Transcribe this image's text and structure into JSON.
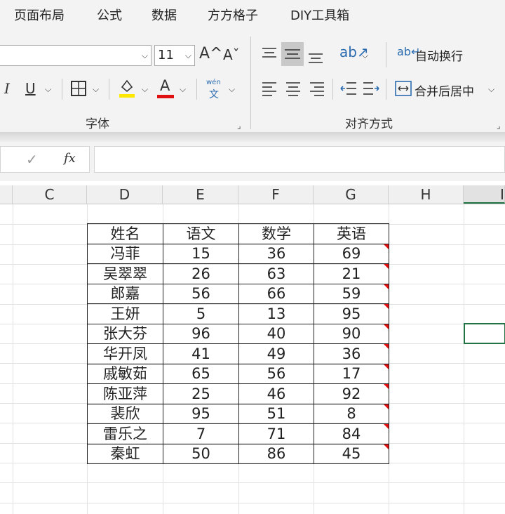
{
  "menu": [
    "页面布局",
    "公式",
    "数据",
    "方方格子",
    "DIY工具箱"
  ],
  "font": {
    "size": "11",
    "grow_icon": "A^",
    "shrink_icon": "Aˇ",
    "italic": "I",
    "underline": "U",
    "font_color_letter": "A",
    "phonetic_top": "wén",
    "phonetic_bottom": "文",
    "group_label": "字体",
    "highlight_color": "#ffe800",
    "font_color": "#e01010"
  },
  "alignment": {
    "wrap_text": "自动换行",
    "merge_center": "合并后居中",
    "group_label": "对齐方式"
  },
  "formula_bar": {
    "fx": "fx",
    "check": "✓",
    "value": ""
  },
  "columns": [
    "C",
    "D",
    "E",
    "F",
    "G",
    "H",
    "I"
  ],
  "table": {
    "headers": [
      "姓名",
      "语文",
      "数学",
      "英语"
    ],
    "rows": [
      [
        "冯菲",
        "15",
        "36",
        "69"
      ],
      [
        "吴翠翠",
        "26",
        "63",
        "21"
      ],
      [
        "郎嘉",
        "56",
        "66",
        "59"
      ],
      [
        "王妍",
        "5",
        "13",
        "95"
      ],
      [
        "张大芬",
        "96",
        "40",
        "90"
      ],
      [
        "华开凤",
        "41",
        "49",
        "36"
      ],
      [
        "戚敏茹",
        "65",
        "56",
        "17"
      ],
      [
        "陈亚萍",
        "25",
        "46",
        "92"
      ],
      [
        "裴欣",
        "95",
        "51",
        "8"
      ],
      [
        "雷乐之",
        "7",
        "71",
        "84"
      ],
      [
        "秦虹",
        "50",
        "86",
        "45"
      ]
    ]
  },
  "colors": {
    "selection": "#217346",
    "comment_flag": "#e01010"
  }
}
